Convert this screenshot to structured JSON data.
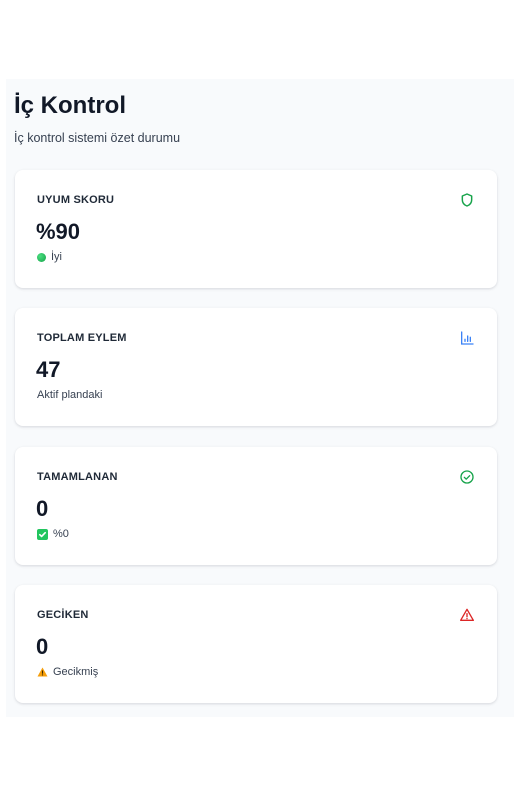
{
  "header": {
    "title": "İç Kontrol",
    "subtitle": "İç kontrol sistemi özet durumu"
  },
  "cards": [
    {
      "label": "UYUM SKORU",
      "value": "%90",
      "sub": "İyi",
      "icon": "shield-icon",
      "color": "#16a34a"
    },
    {
      "label": "TOPLAM EYLEM",
      "value": "47",
      "sub": "Aktif plandaki",
      "icon": "bar-chart-icon",
      "color": "#3b82f6"
    },
    {
      "label": "TAMAMLANAN",
      "value": "0",
      "sub": "%0",
      "icon": "check-circle-icon",
      "color": "#16a34a"
    },
    {
      "label": "GECİKEN",
      "value": "0",
      "sub": "Gecikmiş",
      "icon": "warning-icon",
      "color": "#dc2626"
    }
  ]
}
